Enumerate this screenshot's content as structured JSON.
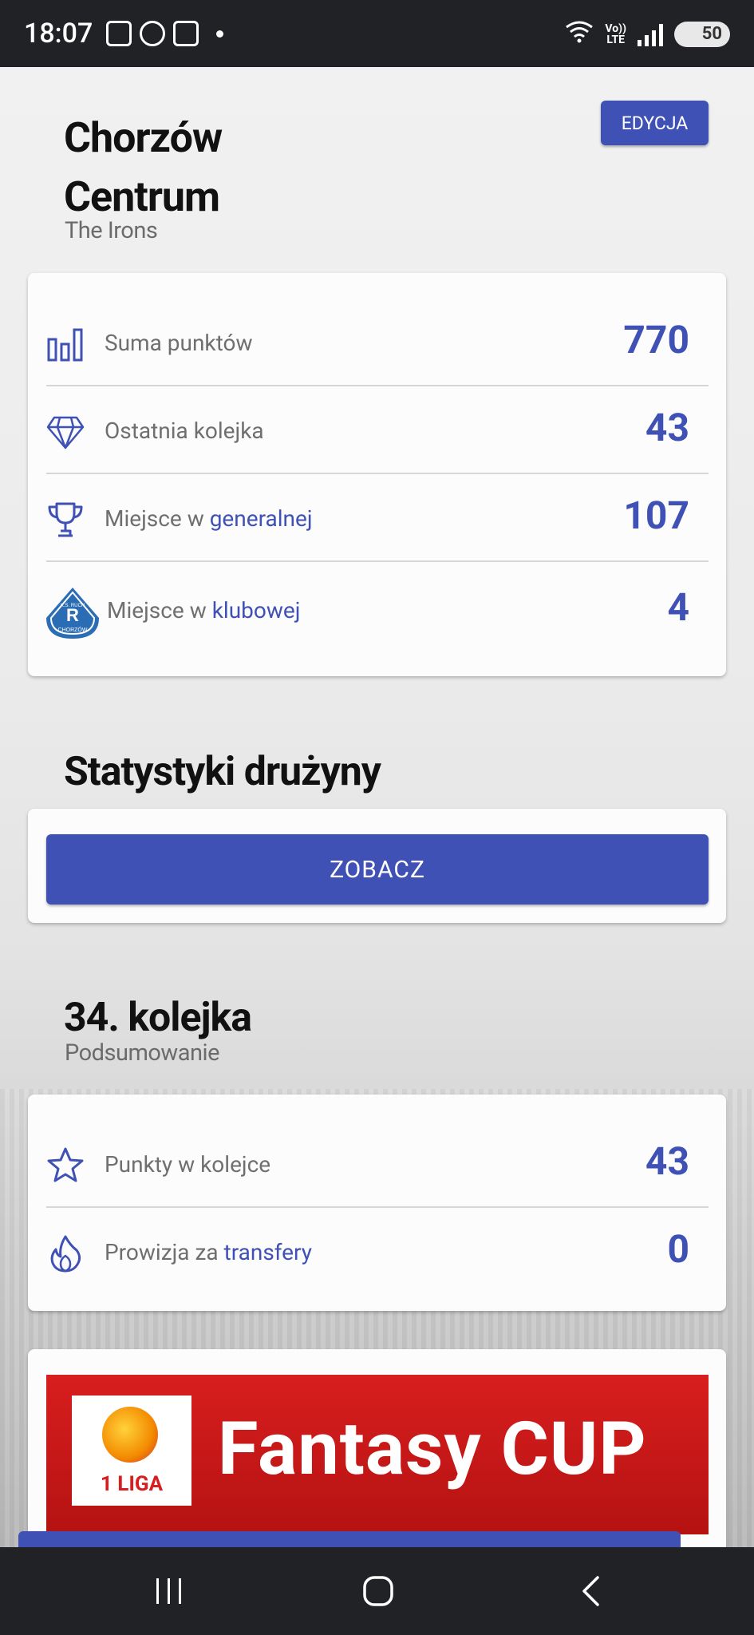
{
  "status_bar": {
    "time": "18:07",
    "battery": "50",
    "network": "LTE",
    "volte": "Vo))",
    "wifi_badge": "5"
  },
  "team": {
    "name_line1": "Chorzów",
    "name_line2": "Centrum",
    "subtitle": "The Irons",
    "edit_label": "EDYCJA"
  },
  "summary": {
    "rows": [
      {
        "icon": "bar-chart-icon",
        "label": "Suma punktów",
        "link": "",
        "value": "770"
      },
      {
        "icon": "diamond-icon",
        "label": "Ostatnia kolejka",
        "link": "",
        "value": "43"
      },
      {
        "icon": "trophy-icon",
        "label": "Miejsce w ",
        "link": "generalnej",
        "value": "107"
      },
      {
        "icon": "club-crest-icon",
        "label": "Miejsce w ",
        "link": "klubowej",
        "value": "4"
      }
    ],
    "crest_text": [
      "K.S. RUCH",
      "CHORZÓW"
    ]
  },
  "stats": {
    "title": "Statystyki drużyny",
    "button_label": "ZOBACZ"
  },
  "round": {
    "title": "34. kolejka",
    "subtitle": "Podsumowanie",
    "rows": [
      {
        "icon": "star-icon",
        "label": "Punkty w kolejce",
        "link": "",
        "value": "43"
      },
      {
        "icon": "fire-icon",
        "label": "Prowizja za ",
        "link": "transfery",
        "value": "0"
      }
    ]
  },
  "banner": {
    "text": "Fantasy CUP",
    "logo_label": "1 LIGA"
  },
  "colors": {
    "accent": "#3f51b5",
    "banner_red": "#d81e1e",
    "bar_dark": "#202226"
  }
}
